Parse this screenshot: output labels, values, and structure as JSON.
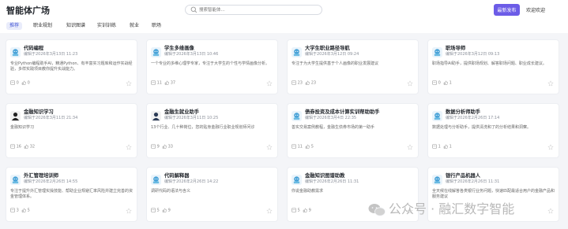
{
  "header": {
    "title": "智能体广场",
    "search_placeholder": "搜索智能体...",
    "publish_label": "最新发布",
    "welcome": "欢迎欢迎"
  },
  "tabs": [
    "推荐",
    "职业规划",
    "知识图谱",
    "实训训练",
    "就业",
    "职场"
  ],
  "active_tab": 0,
  "cards": [
    {
      "name": "代码编程",
      "editor": "编辑于2026年3月13日 11:23",
      "desc": "专业Python编程助手AI，精通Python、有丰富实习题库和运作实战经验，多样实践项目教你提升实战能力。",
      "uses": "0",
      "likes": "0",
      "avatar": "bot",
      "accent": "#4aa3d8"
    },
    {
      "name": "学生多维画像",
      "editor": "编辑于2026年3月13日 10:46",
      "desc": "一个专业的多维心理学专家，专注于大学生的个性与学情画像分析。",
      "uses": "11",
      "likes": "37",
      "avatar": "bot",
      "accent": "#4aa3d8"
    },
    {
      "name": "大学生职业路径导航",
      "editor": "编辑于2026年3月12日 09:24",
      "desc": "专注于为大学生提供基于个人画像的职业发展建议",
      "uses": "23",
      "likes": "23",
      "avatar": "bot",
      "accent": "#4aa3d8"
    },
    {
      "name": "职场导师",
      "editor": "编辑于2026年3月12日 09:13",
      "desc": "职场指导AI助手，提供职场规划、解答职场问题、职业成长建议。",
      "uses": "0",
      "likes": "1",
      "avatar": "bot",
      "accent": "#4aa3d8"
    },
    {
      "name": "金融知识学习",
      "editor": "编辑于2026年3月11日 21:34",
      "desc": "金融知识学习",
      "uses": "16",
      "likes": "32",
      "avatar": "person",
      "accent": "#222"
    },
    {
      "name": "金融生就业助手",
      "editor": "编辑于2026年3月11日 10:25",
      "desc": "13个行业、几十种岗位，您的贴身金融行业职业规划师问诊",
      "uses": "9",
      "likes": "33",
      "avatar": "person",
      "accent": "#2a3a55"
    },
    {
      "name": "债券投资及成本计算实训帮助助手",
      "editor": "编辑于2026年3月4日 22:35",
      "desc": "善实交易案例教程，金融生债券市场的第一助手",
      "uses": "11",
      "likes": "5",
      "avatar": "bot",
      "accent": "#4aa3d8"
    },
    {
      "name": "数据分析师助手",
      "editor": "编辑于2026年2月26日 17:14",
      "desc": "数据处理与分析助手，提供清洗和了的分析结果和洞察。",
      "uses": "1",
      "likes": "1",
      "avatar": "bot",
      "accent": "#4aa3d8"
    },
    {
      "name": "外汇管理培训师",
      "editor": "编辑于2026年2月26日 14:55",
      "desc": "专注于提升外汇管理实操技能、帮助企业规避汇率风险并建立完善的资金管理体系。",
      "uses": "3",
      "likes": "5",
      "avatar": "bot",
      "accent": "#4aa3d8"
    },
    {
      "name": "代码解释器",
      "editor": "编辑于2026年2月26日 14:22",
      "desc": "调研代码的语法与含义",
      "uses": "5",
      "likes": "9",
      "avatar": "bot",
      "accent": "#4aa3d8"
    },
    {
      "name": "金融知识图谱助教",
      "editor": "编辑于2026年2月26日 11:31",
      "desc": "你说金融助教需求",
      "uses": "5",
      "likes": "9",
      "avatar": "bot",
      "accent": "#4aa3d8"
    },
    {
      "name": "银行产品机器人",
      "editor": "编辑于2026年2月26日 11:31",
      "desc": "全天候在线解答各类银行业务问题，快速匹配最适合用户的金融产品和服务建议",
      "uses": "",
      "likes": "",
      "avatar": "bot",
      "accent": "#4aa3d8"
    }
  ],
  "watermark": "公众号 · 融汇数字智能"
}
